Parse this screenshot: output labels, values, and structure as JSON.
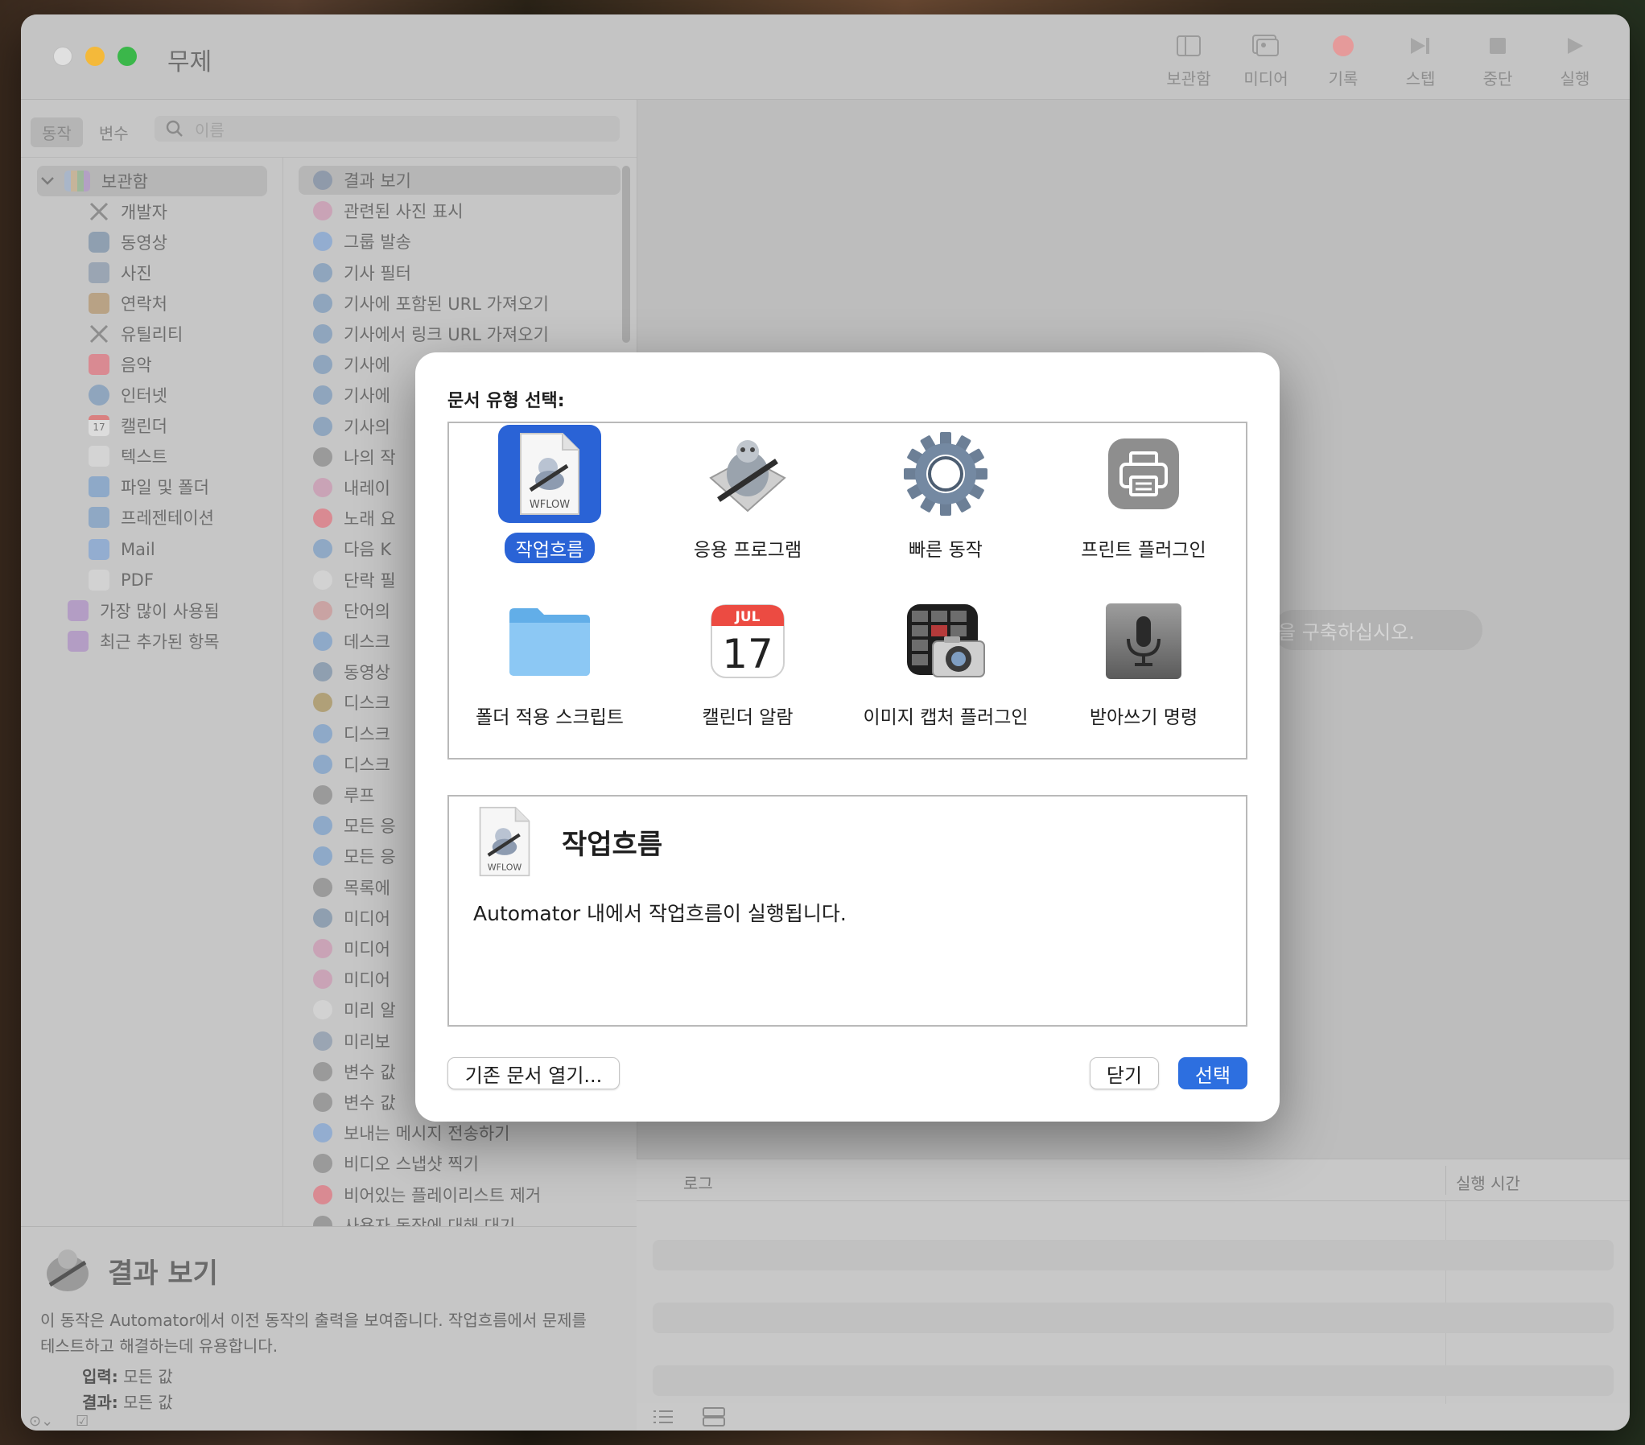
{
  "window": {
    "title": "무제"
  },
  "toolbar": {
    "items": [
      {
        "label": "보관함",
        "icon": "library-icon"
      },
      {
        "label": "미디어",
        "icon": "media-icon"
      },
      {
        "label": "기록",
        "icon": "record-icon"
      },
      {
        "label": "스텝",
        "icon": "step-icon"
      },
      {
        "label": "중단",
        "icon": "stop-icon"
      },
      {
        "label": "실행",
        "icon": "run-icon"
      }
    ]
  },
  "filter": {
    "tabs": [
      "동작",
      "변수"
    ],
    "active_tab": "동작",
    "search_placeholder": "이름"
  },
  "library": {
    "root": "보관함",
    "items": [
      "개발자",
      "동영상",
      "사진",
      "연락처",
      "유틸리티",
      "음악",
      "인터넷",
      "캘린더",
      "텍스트",
      "파일 및 폴더",
      "프레젠테이션",
      "Mail",
      "PDF"
    ],
    "smart": [
      "가장 많이 사용됨",
      "최근 추가된 항목"
    ],
    "calendar_day": "17"
  },
  "actions": {
    "items": [
      "결과 보기",
      "관련된 사진 표시",
      "그룹 발송",
      "기사 필터",
      "기사에 포함된 URL 가져오기",
      "기사에서 링크 URL 가져오기",
      "기사에",
      "기사에",
      "기사의",
      "나의 작",
      "내레이",
      "노래 요",
      "다음 K",
      "단락 필",
      "단어의",
      "데스크",
      "동영상",
      "디스크",
      "디스크",
      "디스크",
      "루프",
      "모든 응",
      "모든 응",
      "목록에",
      "미디어",
      "미디어",
      "미디어",
      "미리 알",
      "미리보",
      "변수 값",
      "변수 값",
      "보내는 메시지 전송하기",
      "비디오 스냅샷 찍기",
      "비어있는 플레이리스트 제거",
      "사용자 동작에 대해 대기"
    ]
  },
  "description": {
    "title": "결과 보기",
    "text": "이 동작은 Automator에서 이전 동작의 출력을 보여줍니다. 작업흐름에서 문제를 테스트하고 해결하는데 유용합니다.",
    "input_label": "입력:",
    "input_value": "모든 값",
    "result_label": "결과:",
    "result_value": "모든 값"
  },
  "canvas": {
    "hint": "을 구축하십시오."
  },
  "log": {
    "col_log": "로그",
    "col_time": "실행 시간"
  },
  "modal": {
    "heading": "문서 유형 선택:",
    "types": [
      {
        "label": "작업흐름",
        "icon": "workflow-doc-icon",
        "selected": true
      },
      {
        "label": "응용 프로그램",
        "icon": "automator-robot-icon"
      },
      {
        "label": "빠른 동작",
        "icon": "gear-icon"
      },
      {
        "label": "프린트 플러그인",
        "icon": "printer-icon"
      },
      {
        "label": "폴더 적용 스크립트",
        "icon": "folder-icon"
      },
      {
        "label": "캘린더 알람",
        "icon": "calendar-icon"
      },
      {
        "label": "이미지 캡처 플러그인",
        "icon": "image-capture-icon"
      },
      {
        "label": "받아쓰기 명령",
        "icon": "microphone-icon"
      }
    ],
    "calendar_month": "JUL",
    "calendar_day": "17",
    "doc_badge": "WFLOW",
    "info_title": "작업흐름",
    "info_text": "Automator 내에서 작업흐름이 실행됩니다.",
    "open_existing": "기존 문서 열기...",
    "close": "닫기",
    "choose": "선택",
    "accent_color": "#2a63d6"
  }
}
